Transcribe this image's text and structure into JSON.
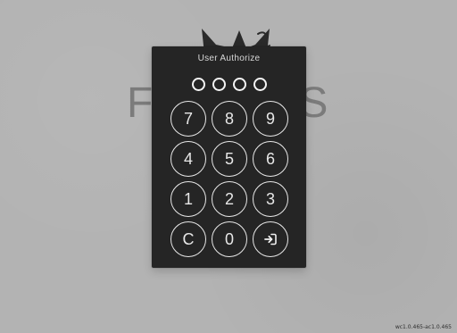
{
  "app": {
    "brand": "FENRIOS",
    "version": "wc1.0.465-ac1.0.465"
  },
  "auth_panel": {
    "title": "User Authorize",
    "pin_slots": 4,
    "keys": [
      {
        "label": "7",
        "type": "digit",
        "name": "key-7"
      },
      {
        "label": "8",
        "type": "digit",
        "name": "key-8"
      },
      {
        "label": "9",
        "type": "digit",
        "name": "key-9"
      },
      {
        "label": "4",
        "type": "digit",
        "name": "key-4"
      },
      {
        "label": "5",
        "type": "digit",
        "name": "key-5"
      },
      {
        "label": "6",
        "type": "digit",
        "name": "key-6"
      },
      {
        "label": "1",
        "type": "digit",
        "name": "key-1"
      },
      {
        "label": "2",
        "type": "digit",
        "name": "key-2"
      },
      {
        "label": "3",
        "type": "digit",
        "name": "key-3"
      },
      {
        "label": "C",
        "type": "clear",
        "name": "clear-button"
      },
      {
        "label": "0",
        "type": "digit",
        "name": "key-0"
      },
      {
        "label": "",
        "type": "submit",
        "name": "login-button",
        "icon": "login-icon"
      }
    ]
  },
  "colors": {
    "background": "#b3b3b3",
    "panel": "#252525",
    "key_outline": "#e8e8e8",
    "brand_text": "#7b7b7b"
  },
  "icons": {
    "logo": "cat-head-icon",
    "login": "login-icon"
  }
}
